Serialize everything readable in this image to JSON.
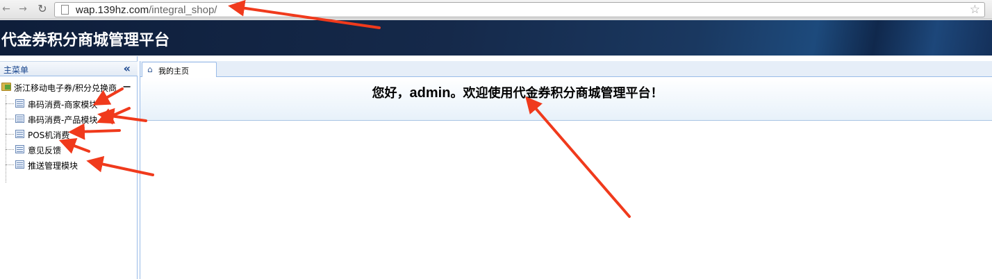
{
  "browser": {
    "url_host": "wap.139hz.com",
    "url_path": "/integral_shop/",
    "back_icon": "back-arrow-icon",
    "forward_icon": "forward-arrow-icon",
    "reload_icon": "reload-icon",
    "bookmark_icon": "star-icon"
  },
  "header": {
    "title": "代金券积分商城管理平台"
  },
  "sidebar": {
    "title": "主菜单",
    "collapse_icon": "double-chevron-left-icon",
    "root": {
      "label": "浙江移动电子券/积分兑换商",
      "toggle": "−"
    },
    "items": [
      {
        "label": "串码消费-商家模块"
      },
      {
        "label": "串码消费-产品模块"
      },
      {
        "label": "POS机消费"
      },
      {
        "label": "意见反馈"
      },
      {
        "label": "推送管理模块"
      }
    ]
  },
  "main": {
    "tabs": [
      {
        "label": "我的主页",
        "icon": "home-icon"
      }
    ],
    "welcome": {
      "prefix": "您好，",
      "user": "admin",
      "suffix": "。欢迎使用代金券积分商城管理平台！"
    }
  },
  "colors": {
    "header_bg": "#15294a",
    "panel_border": "#99bbe8",
    "annotation_arrow": "#f03a1c"
  }
}
